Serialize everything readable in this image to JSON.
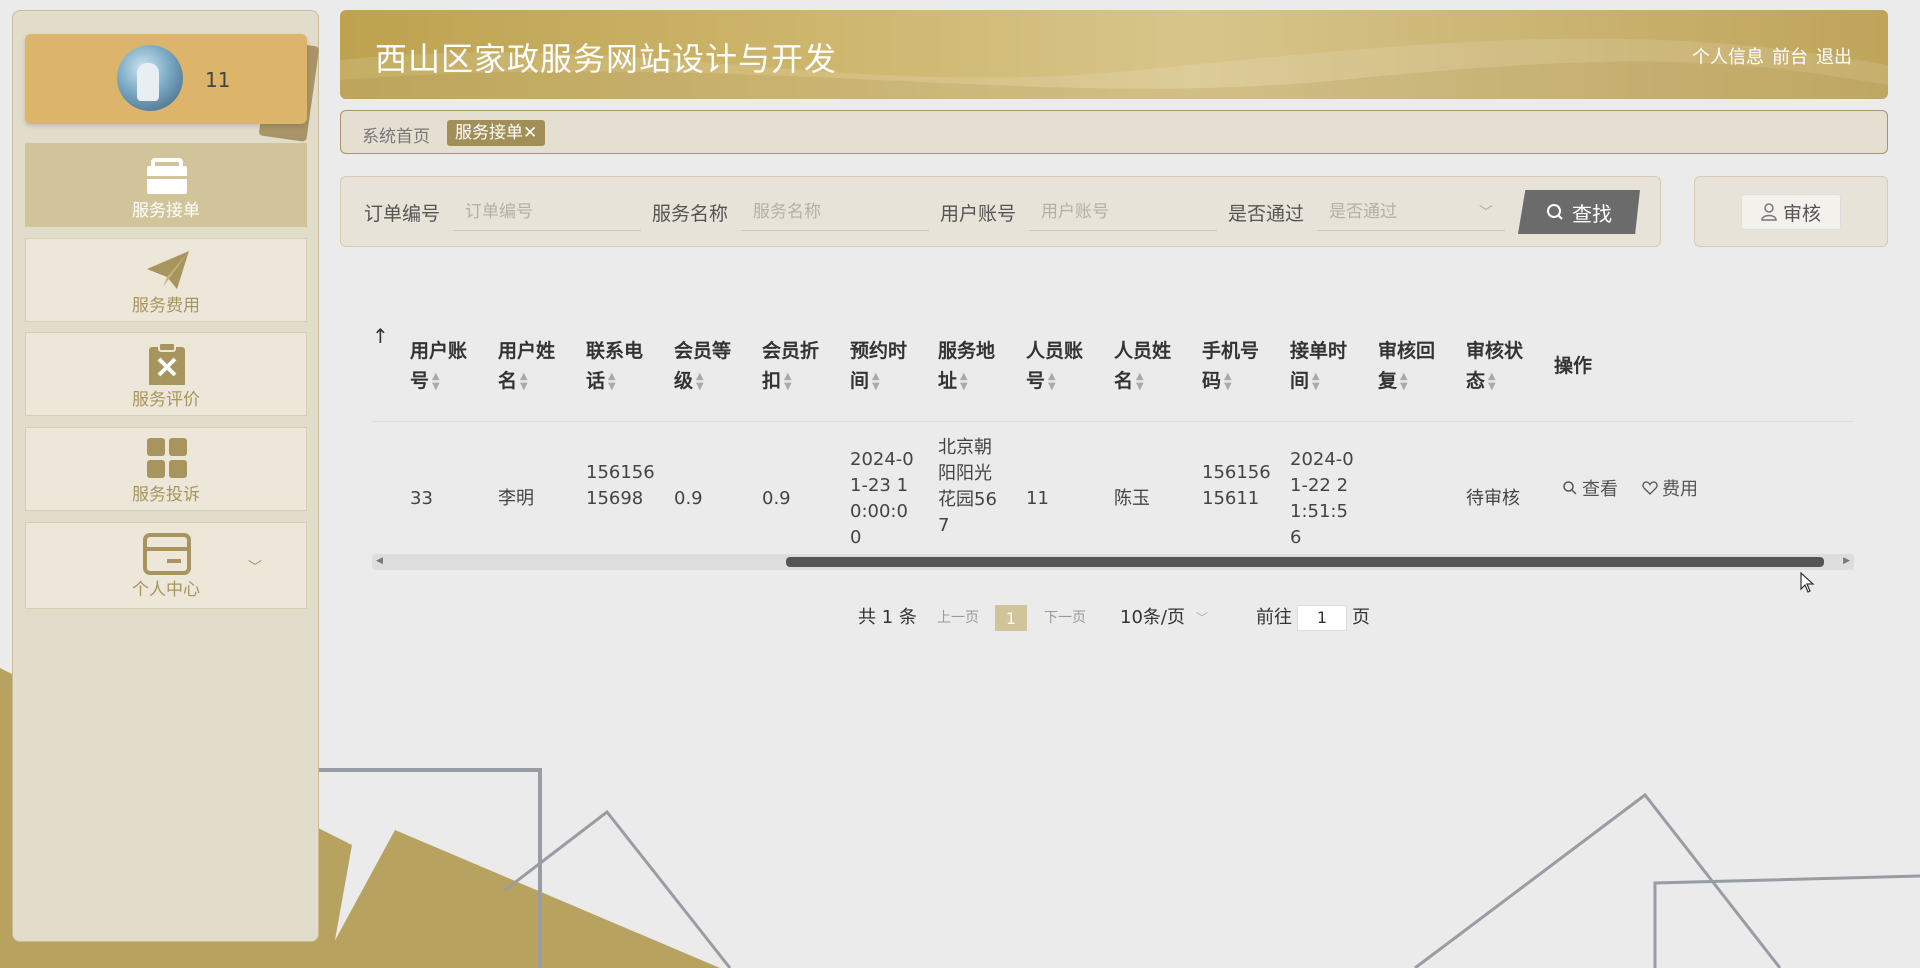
{
  "user": {
    "name": "11"
  },
  "sidebar": {
    "items": [
      {
        "label": "服务接单",
        "icon": "briefcase-icon"
      },
      {
        "label": "服务费用",
        "icon": "paper-plane-icon"
      },
      {
        "label": "服务评价",
        "icon": "clipboard-x-icon"
      },
      {
        "label": "服务投诉",
        "icon": "grid-icon"
      },
      {
        "label": "个人中心",
        "icon": "card-icon"
      }
    ]
  },
  "header": {
    "title": "西山区家政服务网站设计与开发",
    "links": [
      "个人信息",
      "前台",
      "退出"
    ]
  },
  "breadcrumb": {
    "home": "系统首页",
    "current": "服务接单✕"
  },
  "search": {
    "fields": [
      {
        "label": "订单编号",
        "placeholder": "订单编号"
      },
      {
        "label": "服务名称",
        "placeholder": "服务名称"
      },
      {
        "label": "用户账号",
        "placeholder": "用户账号"
      },
      {
        "label": "是否通过",
        "placeholder": "是否通过"
      }
    ],
    "search_button": "查找",
    "audit_button": "审核"
  },
  "table": {
    "headers": [
      "用户账号",
      "用户姓名",
      "联系电话",
      "会员等级",
      "会员折扣",
      "预约时间",
      "服务地址",
      "人员账号",
      "人员姓名",
      "手机号码",
      "接单时间",
      "审核回复",
      "审核状态",
      "操作"
    ],
    "rows": [
      {
        "cells": [
          "33",
          "李明",
          "15615615698",
          "0.9",
          "0.9",
          "2024-01-23 10:00:00",
          "北京朝阳阳光花园567",
          "11",
          "陈玉",
          "15615615611",
          "2024-01-22 21:51:56",
          "",
          "待审核"
        ],
        "actions": [
          "查看",
          "费用"
        ]
      }
    ]
  },
  "pagination": {
    "total": "共 1 条",
    "prev": "上一页",
    "current": "1",
    "next": "下一页",
    "page_size": "10条/页",
    "goto_label": "前往",
    "goto_value": "1",
    "page_suffix": "页"
  },
  "colors": {
    "accent": "#a18f57",
    "header": "#c9b06a",
    "active_menu": "#d2c49a"
  }
}
